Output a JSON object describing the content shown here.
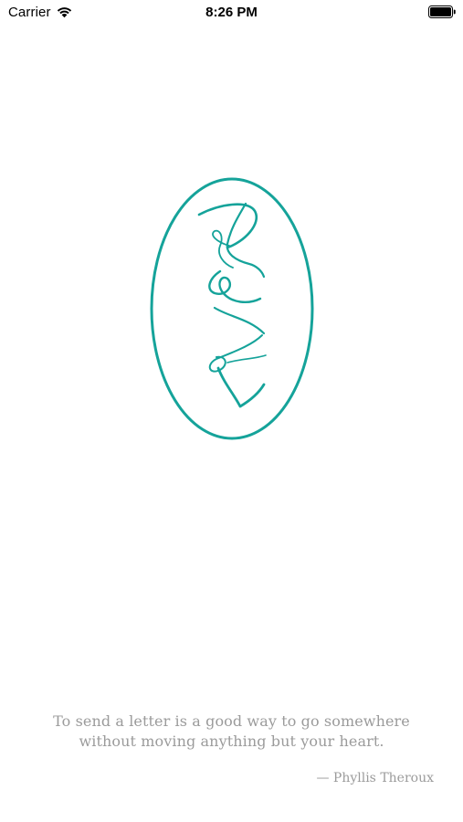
{
  "status_bar": {
    "carrier": "Carrier",
    "time": "8:26 PM",
    "wifi_icon": "wifi-icon",
    "battery_icon": "battery-icon"
  },
  "logo": {
    "icon": "monogram-oval-logo",
    "color": "#15a39a"
  },
  "quote": {
    "line1": "To send a letter is a good way to go somewhere",
    "line2": "without moving anything but your heart.",
    "attribution": "— Phyllis Theroux",
    "text_color": "#9b9b9b"
  }
}
